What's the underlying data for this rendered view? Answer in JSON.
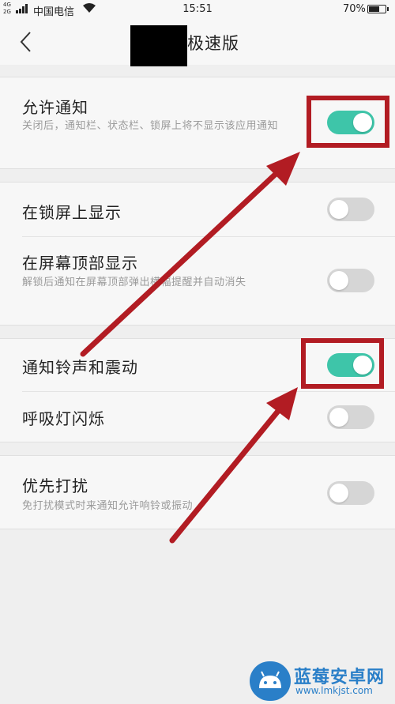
{
  "status_bar": {
    "network_top": "4G",
    "network_bottom": "2G",
    "carrier": "中国电信",
    "time": "15:51",
    "battery_text": "70%",
    "battery_level": 0.7
  },
  "header": {
    "title": "极速版",
    "back_icon": "chevron-left-icon"
  },
  "settings": {
    "allow_notifications": {
      "title": "允许通知",
      "desc": "关闭后，通知栏、状态栏、锁屏上将不显示该应用通知",
      "on": true
    },
    "lock_screen": {
      "title": "在锁屏上显示",
      "on": false
    },
    "top_banner": {
      "title": "在屏幕顶部显示",
      "desc": "解锁后通知在屏幕顶部弹出横幅提醒并自动消失",
      "on": false
    },
    "ring_vibrate": {
      "title": "通知铃声和震动",
      "on": true
    },
    "breathing_light": {
      "title": "呼吸灯闪烁",
      "on": false
    },
    "priority": {
      "title": "优先打扰",
      "desc": "免打扰模式时来通知允许响铃或振动",
      "on": false
    }
  },
  "annotation": {
    "highlight_color": "#b21c23",
    "toggle_on_color": "#3ec5a9"
  },
  "watermark": {
    "name": "蓝莓安卓网",
    "url": "www.lmkjst.com"
  }
}
